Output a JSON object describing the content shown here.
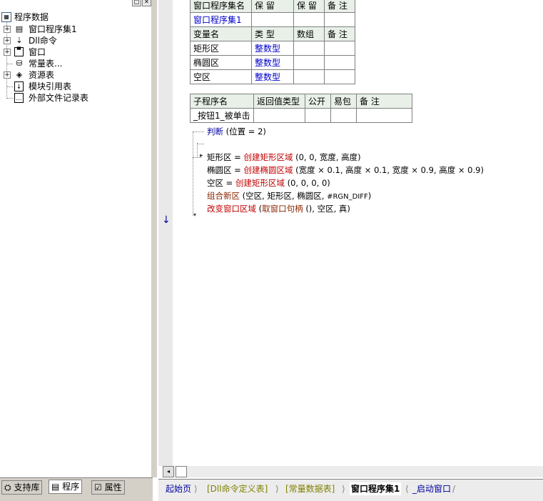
{
  "tree": {
    "root_label": "程序数据",
    "items": [
      {
        "label": "窗口程序集1",
        "icon": "assembly-icon",
        "expander": "+"
      },
      {
        "label": "Dll命令",
        "icon": "dll-icon",
        "expander": "+"
      },
      {
        "label": "窗口",
        "icon": "window-icon",
        "expander": "+"
      },
      {
        "label": "常量表...",
        "icon": "constant-table-icon",
        "expander": ""
      },
      {
        "label": "资源表",
        "icon": "resource-icon",
        "expander": "+"
      },
      {
        "label": "模块引用表",
        "icon": "module-ref-icon",
        "expander": ""
      },
      {
        "label": "外部文件记录表",
        "icon": "external-file-icon",
        "expander": ""
      }
    ]
  },
  "left_tabs": [
    {
      "label": "支持库",
      "icon": "library-icon"
    },
    {
      "label": "程序",
      "icon": "program-icon"
    },
    {
      "label": "属性",
      "icon": "property-icon"
    }
  ],
  "assembly_table": {
    "header": [
      "窗口程序集名",
      "保 留",
      "保 留",
      "备 注"
    ],
    "row": [
      "窗口程序集1",
      "",
      "",
      ""
    ],
    "var_header": [
      "变量名",
      "类 型",
      "数组",
      "备 注"
    ],
    "vars": [
      {
        "name": "矩形区",
        "type": "整数型"
      },
      {
        "name": "椭圆区",
        "type": "整数型"
      },
      {
        "name": "空区",
        "type": "整数型"
      }
    ]
  },
  "sub_table": {
    "header": [
      "子程序名",
      "返回值类型",
      "公开",
      "易包",
      "备 注"
    ],
    "row": [
      "_按钮1_被单击",
      "",
      "",
      "",
      ""
    ]
  },
  "code": {
    "line1": {
      "kw": "判断",
      "rest": "(位置 = 2)"
    },
    "line3": {
      "a": "矩形区 = ",
      "fn": "创建矩形区域",
      "b": "(0, 0, 宽度, 高度)"
    },
    "line4": {
      "a": "椭圆区 = ",
      "fn": "创建椭圆区域",
      "b": "(宽度 × 0.1, 高度 × 0.1, 宽度 × 0.9, 高度 × 0.9)"
    },
    "line5": {
      "a": "空区 = ",
      "fn": "创建矩形区域",
      "b": "(0, 0, 0, 0)"
    },
    "line6": {
      "fn": "组合新区",
      "b": "(空区, 矩形区, 椭圆区, ",
      "c": "#RGN_DIFF",
      "d": ")"
    },
    "line7": {
      "fn": "改变窗口区域",
      "b": "(",
      "fn2": "取窗口句柄",
      "c": "(), 空区, 真)"
    }
  },
  "bottom_tabs": [
    {
      "label": "起始页"
    },
    {
      "label": "[Dll命令定义表]"
    },
    {
      "label": "[常量数据表]"
    },
    {
      "label": "窗口程序集1"
    },
    {
      "label": "_启动窗口"
    }
  ],
  "colors": {
    "accent_blue": "#0000a0",
    "function_red": "#c00000",
    "type_blue": "#0000cc",
    "panel_gray": "#d4d0c8"
  }
}
